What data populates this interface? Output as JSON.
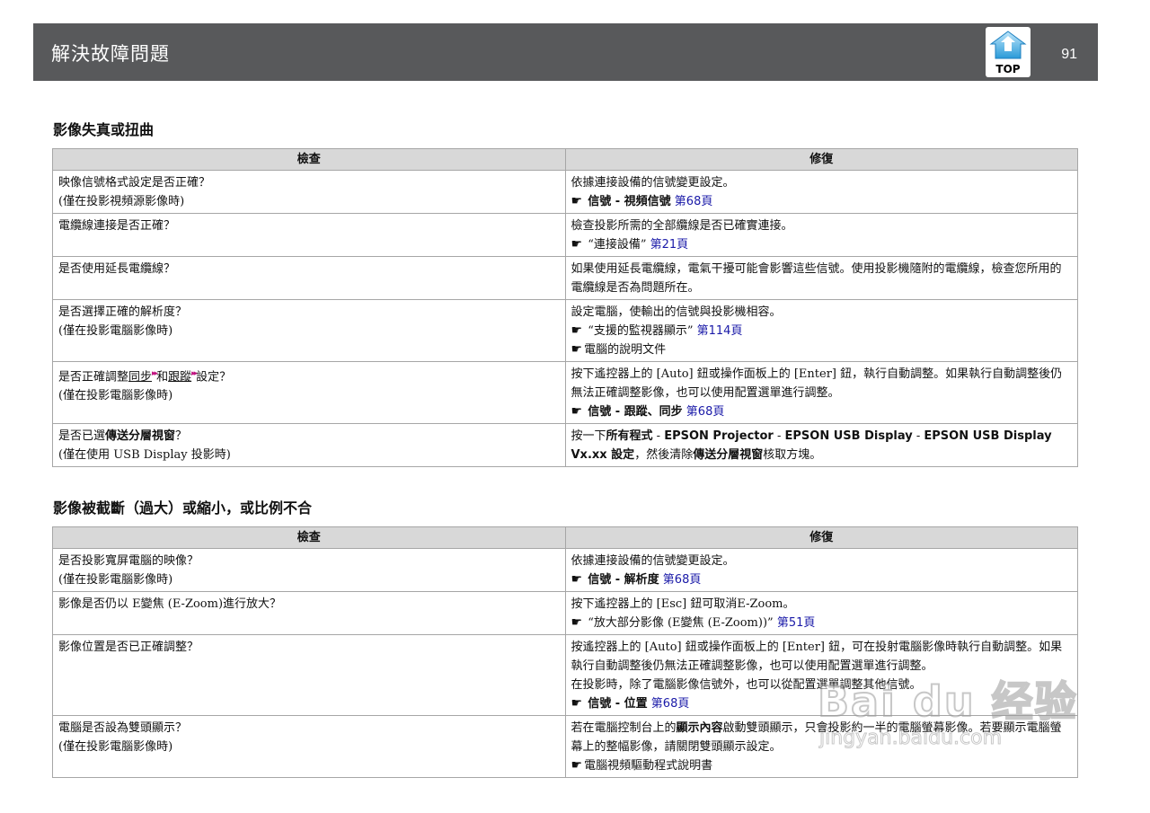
{
  "header": {
    "title": "解決故障問題",
    "page_number": "91",
    "top_label": "TOP",
    "accent": "#58595b"
  },
  "sections": [
    {
      "heading": "影像失真或扭曲",
      "col_check": "檢查",
      "col_fix": "修復",
      "rows": [
        {
          "check": [
            "映像信號格式設定是否正確？",
            "(僅在投影視頻源影像時)"
          ],
          "fix_text": "依據連接設備的信號變更設定。",
          "fix_ref_path": "信號 - 視頻信號",
          "fix_ref_page": "第68頁"
        },
        {
          "check": [
            "電纜線連接是否正確？"
          ],
          "fix_text": "檢查投影所需的全部纜線是否已確實連接。",
          "fix_ref_path": "“連接設備”",
          "fix_ref_page": "第21頁"
        },
        {
          "check": [
            "是否使用延長電纜線？"
          ],
          "fix_text": "如果使用延長電纜線，電氣干擾可能會影響這些信號。使用投影機隨附的電纜線，檢查您所用的電纜線是否為問題所在。"
        },
        {
          "check": [
            "是否選擇正確的解析度？",
            "(僅在投影電腦影像時)"
          ],
          "fix_text": "設定電腦，使輸出的信號與投影機相容。",
          "fix_ref_path": "“支援的監視器顯示”",
          "fix_ref_page": "第114頁",
          "fix_extra": "電腦的說明文件"
        },
        {
          "check_prefix": "是否正確調整",
          "check_link1": "同步",
          "check_mid": "和",
          "check_link2": "跟蹤",
          "check_suffix": "設定？",
          "check_line2": "(僅在投影電腦影像時)",
          "fix_text": "按下遙控器上的 [Auto] 鈕或操作面板上的 [Enter] 鈕，執行自動調整。如果執行自動調整後仍無法正確調整影像，也可以使用配置選單進行調整。",
          "fix_ref_path": "信號 - 跟蹤、同步",
          "fix_ref_page": "第68頁"
        },
        {
          "check_prefix": "是否已選",
          "check_bold": "傳送分層視窗",
          "check_suffix": "？",
          "check_line2": "(僅在使用 USB Display 投影時)",
          "fix_a": "按一下",
          "fix_b": "所有程式",
          "fix_c": " - ",
          "fix_d": "EPSON Projector",
          "fix_e": " - ",
          "fix_f": "EPSON USB Display",
          "fix_g": " - ",
          "fix_h": "EPSON USB Display Vx.xx 設定",
          "fix_i": "，然後清除",
          "fix_j": "傳送分層視窗",
          "fix_k": "核取方塊。"
        }
      ]
    },
    {
      "heading": "影像被截斷（過大）或縮小，或比例不合",
      "col_check": "檢查",
      "col_fix": "修復",
      "rows": [
        {
          "check": [
            "是否投影寬屏電腦的映像？",
            "(僅在投影電腦影像時)"
          ],
          "fix_text": "依據連接設備的信號變更設定。",
          "fix_ref_path": "信號 - 解析度",
          "fix_ref_page": "第68頁"
        },
        {
          "check": [
            "影像是否仍以 E變焦 (E-Zoom)進行放大？"
          ],
          "fix_text": "按下遙控器上的 [Esc] 鈕可取消E-Zoom。",
          "fix_ref_path": "“放大部分影像 (E變焦 (E-Zoom))”",
          "fix_ref_page": "第51頁"
        },
        {
          "check": [
            "影像位置是否已正確調整？"
          ],
          "fix_text": "按遙控器上的 [Auto] 鈕或操作面板上的 [Enter] 鈕，可在投射電腦影像時執行自動調整。如果執行自動調整後仍無法正確調整影像，也可以使用配置選單進行調整。",
          "fix_text2": "在投影時，除了電腦影像信號外，也可以從配置選單調整其他信號。",
          "fix_ref_path": "信號 - 位置",
          "fix_ref_page": "第68頁"
        },
        {
          "check": [
            "電腦是否設為雙頭顯示？",
            "(僅在投影電腦影像時)"
          ],
          "fix_a": "若在電腦控制台上的",
          "fix_b": "顯示內容",
          "fix_c": "啟動雙頭顯示，只會投影約一半的電腦螢幕影像。若要顯示電腦螢幕上的整幅影像，請關閉雙頭顯示設定。",
          "fix_extra": "電腦視頻驅動程式說明書"
        }
      ]
    }
  ],
  "watermark": {
    "brand": "Bai du 经验",
    "url": "jingyan.baidu.com"
  }
}
